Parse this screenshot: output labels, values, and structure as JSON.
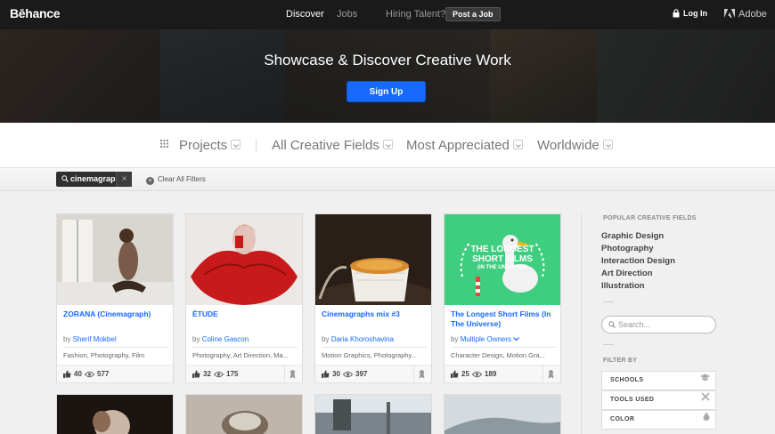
{
  "nav": {
    "logo": "Bēhance",
    "discover": "Discover",
    "jobs": "Jobs",
    "hiring": "Hiring Talent?",
    "post_job": "Post a Job",
    "login": "Log In",
    "adobe": "Adobe"
  },
  "hero": {
    "title": "Showcase & Discover Creative Work",
    "signup": "Sign Up"
  },
  "filters": {
    "projects": "Projects",
    "fields": "All Creative Fields",
    "sort": "Most Appreciated",
    "location": "Worldwide"
  },
  "active_filter": {
    "tag": "cinemagraph",
    "remove": "×",
    "clear_all": "Clear All Filters"
  },
  "projects": [
    {
      "title": "ZORANA (Cinemagraph)",
      "by": "by",
      "owner": "Sherif Mokbel",
      "fields": "Fashion, Photography, Film",
      "likes": "40",
      "views": "577"
    },
    {
      "title": "ÉTUDE",
      "by": "by",
      "owner": "Coline Gascon",
      "fields": "Photography, Art Direction, Ma...",
      "likes": "32",
      "views": "175"
    },
    {
      "title": "Cinemagraphs mix #3",
      "by": "by",
      "owner": "Daria Khoroshavina",
      "fields": "Motion Graphics, Photography...",
      "likes": "30",
      "views": "397"
    },
    {
      "title": "The Longest Short Films (In The Universe)",
      "by": "by",
      "owner": "Multiple Owners",
      "fields": "Character Design, Motion Gra...",
      "likes": "25",
      "views": "189"
    }
  ],
  "thumb4_text": [
    "THE LONGEST",
    "SHORT FILMS",
    "(IN THE UNIVERSE)"
  ],
  "sidebar": {
    "popular_heading": "POPULAR CREATIVE FIELDS",
    "fields": [
      "Graphic Design",
      "Photography",
      "Interaction Design",
      "Art Direction",
      "Illustration"
    ],
    "search_placeholder": "Search...",
    "filter_heading": "FILTER BY",
    "filter_boxes": [
      "SCHOOLS",
      "TOOLS USED",
      "COLOR"
    ]
  },
  "colors": {
    "accent": "#1769ff",
    "nav_bg": "#1a1a1a",
    "thumb4_bg": "#3fce7f"
  }
}
